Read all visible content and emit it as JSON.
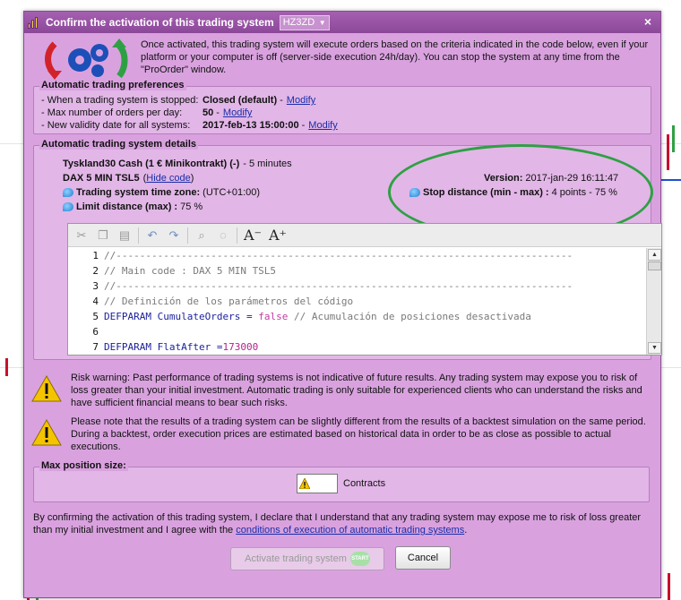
{
  "window": {
    "title": "Confirm the activation of this trading system",
    "system_select": "HZ3ZD",
    "close": "×"
  },
  "intro": {
    "text": "Once activated, this trading system will execute orders based on the criteria indicated in the code below, even if your platform or your computer is off (server-side execution 24h/day). You can stop the system at any time from the \"ProOrder\" window."
  },
  "preferences": {
    "title": "Automatic trading preferences",
    "rows": [
      {
        "label": "- When a trading system is stopped:",
        "value": "Closed (default)",
        "link": "Modify"
      },
      {
        "label": "- Max number of orders per day:",
        "value": "50",
        "link": "Modify"
      },
      {
        "label": "- New validity date for all systems:",
        "value": "2017-feb-13 15:00:00",
        "link": "Modify"
      }
    ]
  },
  "details": {
    "title": "Automatic trading system details",
    "instrument": "Tyskland30 Cash (1 € Minikontrakt) (-)",
    "timeframe": "- 5 minutes",
    "system_name": "DAX 5 MIN TSL5",
    "hide_code": "Hide code",
    "timezone_label": "Trading system time zone:",
    "timezone_value": "(UTC+01:00)",
    "limit_label": "Limit distance (max) :",
    "limit_value": "75 %",
    "version_label": "Version:",
    "version_value": "2017-jan-29 16:11:47",
    "stop_label": "Stop distance (min - max) :",
    "stop_value": "4 points - 75 %"
  },
  "code_lines": [
    {
      "n": "1",
      "text": "//-----------------------------------------------------------------------------"
    },
    {
      "n": "2",
      "text": "// Main code : DAX 5 MIN TSL5"
    },
    {
      "n": "3",
      "text": "//-----------------------------------------------------------------------------"
    },
    {
      "n": "4",
      "text": "// Definición de los parámetros del código"
    },
    {
      "n": "5",
      "kw": "DEFPARAM",
      "rest": " CumulateOrders = ",
      "val": "false",
      "comment": " // Acumulación de posiciones desactivada"
    },
    {
      "n": "6",
      "text": ""
    },
    {
      "n": "7",
      "kw": "DEFPARAM",
      "rest": " FlatAfter =",
      "num": "173000"
    }
  ],
  "warnings": [
    "Risk warning: Past performance of trading systems is not indicative of future results. Any trading system may expose you to risk of loss greater than your initial investment. Automatic trading is only suitable for experienced clients who can understand the risks and have sufficient financial means to bear such risks.",
    "Please note that the results of a trading system can be slightly different from the results of a backtest simulation on the same period. During a backtest, order execution prices are estimated based on historical data in order to be as close as possible to actual executions."
  ],
  "position": {
    "title": "Max position size:",
    "value": "",
    "unit": "Contracts"
  },
  "declaration": {
    "text": "By confirming the activation of this trading system, I declare that I understand that any trading system may expose me to risk of loss greater than my initial investment and I agree with the ",
    "link": "conditions of execution of automatic trading systems",
    "end": "."
  },
  "buttons": {
    "activate": "Activate trading system",
    "start_badge": "START",
    "cancel": "Cancel"
  },
  "colors": {
    "titlebar": "#8b4898",
    "dialog": "#d9a2df",
    "ellipse": "#2ea043",
    "link": "#1a2ea8"
  }
}
